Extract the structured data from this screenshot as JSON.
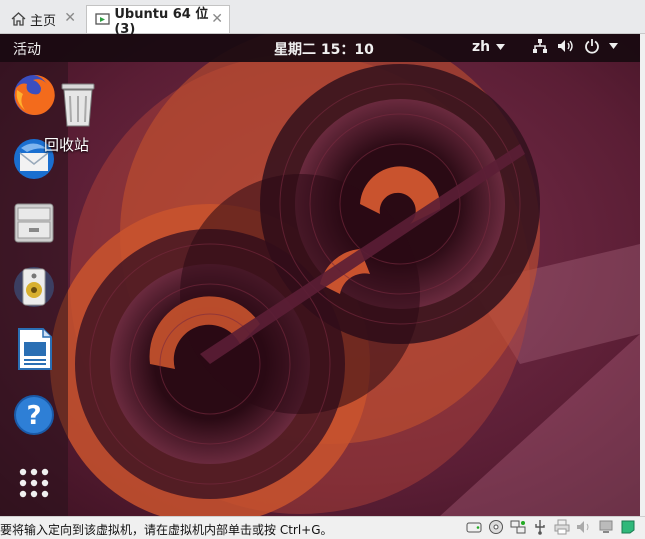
{
  "tabs": {
    "home": {
      "label": "主页"
    },
    "vm": {
      "label": "Ubuntu 64 位 (3)"
    }
  },
  "topbar": {
    "activities": "活动",
    "clock": "星期二 15：10",
    "input_method": "zh"
  },
  "desktop": {
    "trash_label": "回收站"
  },
  "dock": {
    "items": [
      "firefox-icon",
      "thunderbird-icon",
      "files-icon",
      "rhythmbox-icon",
      "libreoffice-writer-icon",
      "help-icon",
      "show-applications-icon"
    ]
  },
  "statusbar": {
    "message": "要将输入定向到该虚拟机，请在虚拟机内部单击或按 Ctrl+G。"
  },
  "colors": {
    "wallpaper_base": "#5a1e2e",
    "wallpaper_orange": "#c9532e",
    "wallpaper_magenta": "#a0406a",
    "topbar": "#180a10"
  }
}
